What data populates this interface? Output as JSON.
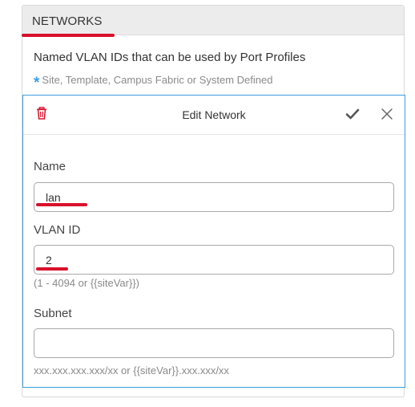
{
  "section": {
    "title": "NETWORKS",
    "description": "Named VLAN IDs that can be used by Port Profiles",
    "legend_text": "Site, Template, Campus Fabric or System Defined",
    "legend_symbol": "*"
  },
  "edit_card": {
    "title": "Edit Network",
    "fields": {
      "name": {
        "label": "Name",
        "value": "lan"
      },
      "vlan_id": {
        "label": "VLAN ID",
        "value": "2",
        "hint": "(1 - 4094 or {{siteVar}})"
      },
      "subnet": {
        "label": "Subnet",
        "value": "",
        "hint": "xxx.xxx.xxx.xxx/xx or {{siteVar}}.xxx.xxx/xx"
      }
    }
  },
  "icons": {
    "delete": "trash-icon",
    "save": "check-icon",
    "close": "close-icon"
  },
  "colors": {
    "accent": "#3f9de0",
    "annotation_red": "#d9112b",
    "delete_red": "#d9112b",
    "header_gray": "#ececec"
  }
}
